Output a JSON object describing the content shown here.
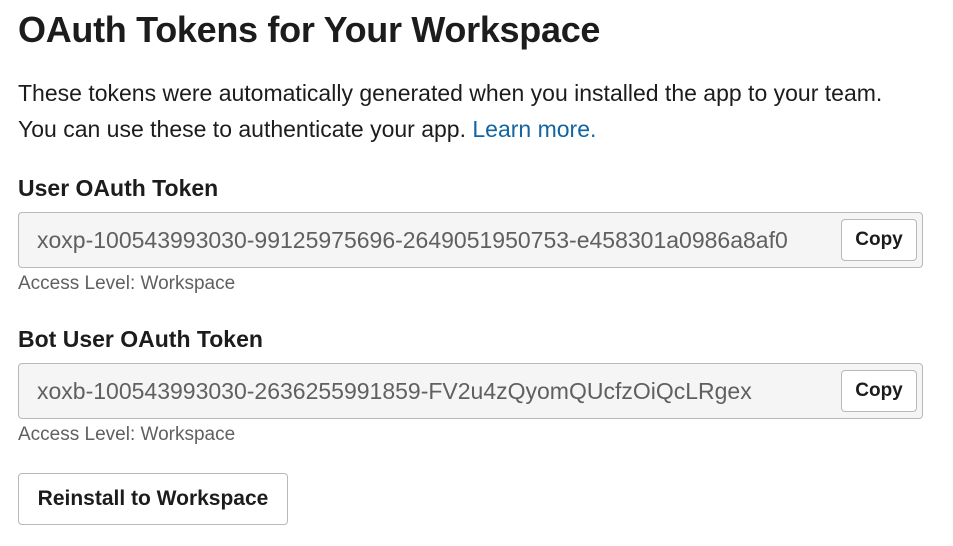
{
  "page": {
    "title": "OAuth Tokens for Your Workspace",
    "description": "These tokens were automatically generated when you installed the app to your team. You can use these to authenticate your app.",
    "learn_more_link": "Learn more."
  },
  "tokens": {
    "user": {
      "label": "User OAuth Token",
      "value": "xoxp-100543993030-99125975696-2649051950753-e458301a0986a8af0",
      "copy_label": "Copy",
      "access_level": "Access Level: Workspace"
    },
    "bot": {
      "label": "Bot User OAuth Token",
      "value": "xoxb-100543993030-2636255991859-FV2u4zQyomQUcfzOiQcLRgex",
      "copy_label": "Copy",
      "access_level": "Access Level: Workspace"
    }
  },
  "actions": {
    "reinstall_label": "Reinstall to Workspace"
  },
  "colors": {
    "text": "#1d1c1d",
    "muted_text": "#616061",
    "link": "#1264a3",
    "field_background": "#f5f5f5",
    "border": "#b8b8b8"
  }
}
